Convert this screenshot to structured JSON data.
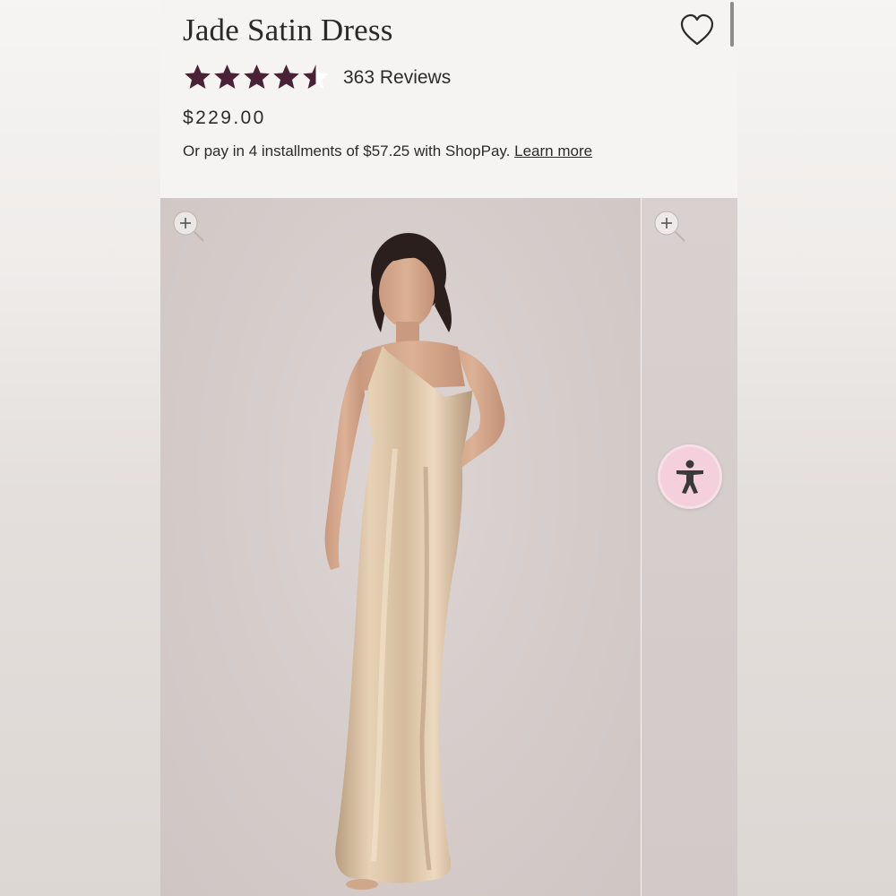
{
  "product": {
    "title": "Jade Satin Dress",
    "rating": 4.5,
    "rating_max": 5,
    "reviews_label": "363 Reviews",
    "price": "$229.00",
    "installments_text": "Or pay in 4 installments of $57.25 with ShopPay.",
    "learn_more_label": "Learn more"
  },
  "icons": {
    "wishlist": "heart-outline-icon",
    "zoom": "zoom-in-icon",
    "accessibility": "accessibility-person-icon"
  },
  "colors": {
    "star": "#4a2236",
    "text": "#2b2b2b",
    "accessibility_button": "#f4cfdc"
  }
}
